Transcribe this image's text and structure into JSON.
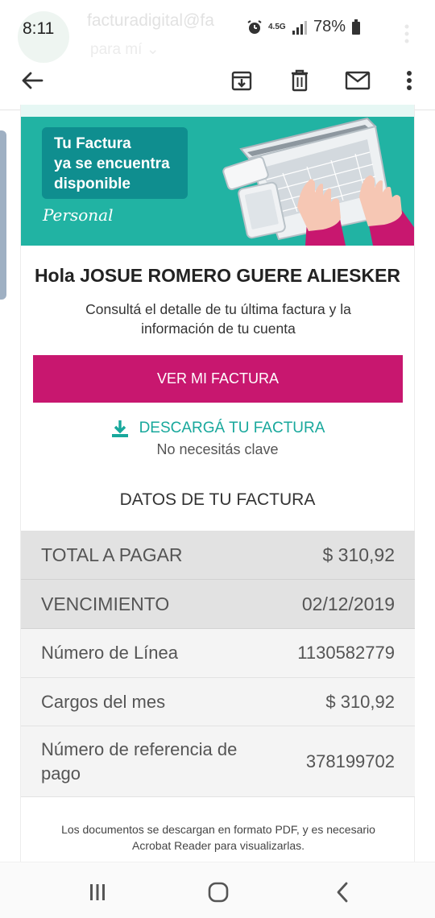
{
  "status_bar": {
    "time": "8:11",
    "network": "4.5G",
    "battery": "78%"
  },
  "background_email": {
    "sender": "facturadigital@fa",
    "to": "para mí"
  },
  "app_bar": {
    "icons": [
      "back-arrow-icon",
      "archive-icon",
      "trash-icon",
      "mail-icon",
      "more-vert-icon"
    ]
  },
  "banner": {
    "line1": "Tu Factura",
    "line2": "ya se encuentra",
    "line3": "disponible",
    "brand": "Personal"
  },
  "greeting": "Hola JOSUE ROMERO GUERE ALIESKER",
  "subtitle": "Consultá el detalle de tu última factura y la información de tu cuenta",
  "cta_label": "VER MI FACTURA",
  "download": {
    "label": "DESCARGÁ TU FACTURA",
    "note": "No necesitás clave"
  },
  "section_title": "DATOS DE TU FACTURA",
  "details": [
    {
      "label": "TOTAL A PAGAR",
      "value": "$ 310,92"
    },
    {
      "label": "VENCIMIENTO",
      "value": "02/12/2019"
    },
    {
      "label": "Número de Línea",
      "value": "1130582779"
    },
    {
      "label": "Cargos del mes",
      "value": "$ 310,92"
    },
    {
      "label": "Número de referencia de pago",
      "value": "378199702"
    }
  ],
  "footnote": "Los documentos se descargan en formato PDF, y es necesario Acrobat Reader para visualizarlas.",
  "colors": {
    "brand_magenta": "#c8176f",
    "teal": "#21b3a3",
    "teal_dark": "#0f8e8f",
    "link_teal": "#18a89c"
  }
}
